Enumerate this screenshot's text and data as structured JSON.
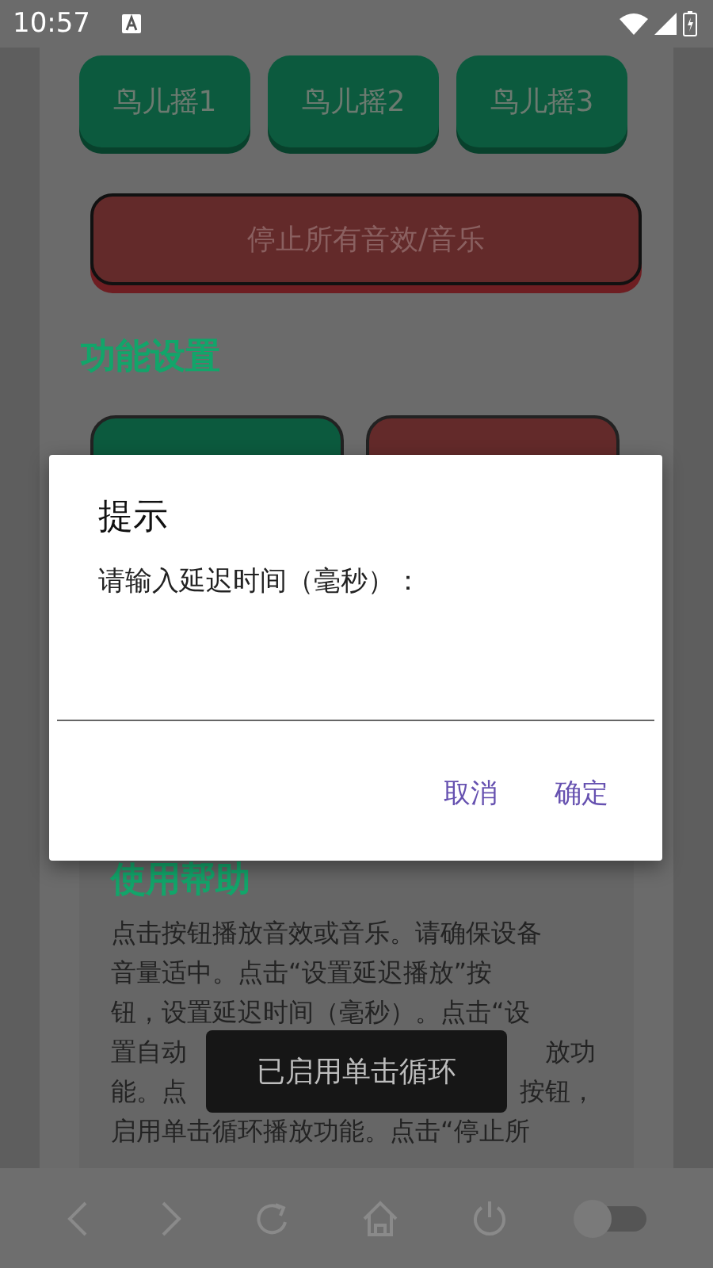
{
  "status_bar": {
    "time": "10:57"
  },
  "sound_buttons": [
    {
      "label": "鸟儿摇1"
    },
    {
      "label": "鸟儿摇2"
    },
    {
      "label": "鸟儿摇3"
    }
  ],
  "stop_button": {
    "label": "停止所有音效/音乐"
  },
  "settings": {
    "title": "功能设置"
  },
  "help": {
    "title": "使用帮助",
    "lines": [
      {
        "text": "点击按钮播放音效或音乐。请确保设备"
      },
      {
        "text": "音量适中。点击“设置延迟播放”按"
      },
      {
        "text": "钮，设置延迟时间（毫秒）。点击“设"
      },
      {
        "text": "置自动",
        "right": "放功"
      },
      {
        "text": "能。点",
        "right": "按钮，"
      },
      {
        "text": "启用单击循环播放功能。点击“停止所"
      }
    ]
  },
  "dialog": {
    "title": "提示",
    "message": "请输入延迟时间（毫秒）：",
    "buttons": [
      "取消",
      "确定"
    ]
  },
  "toast": {
    "text": "已启用单击循环"
  },
  "nav_bar": {
    "toggle": {
      "on": false
    }
  }
}
